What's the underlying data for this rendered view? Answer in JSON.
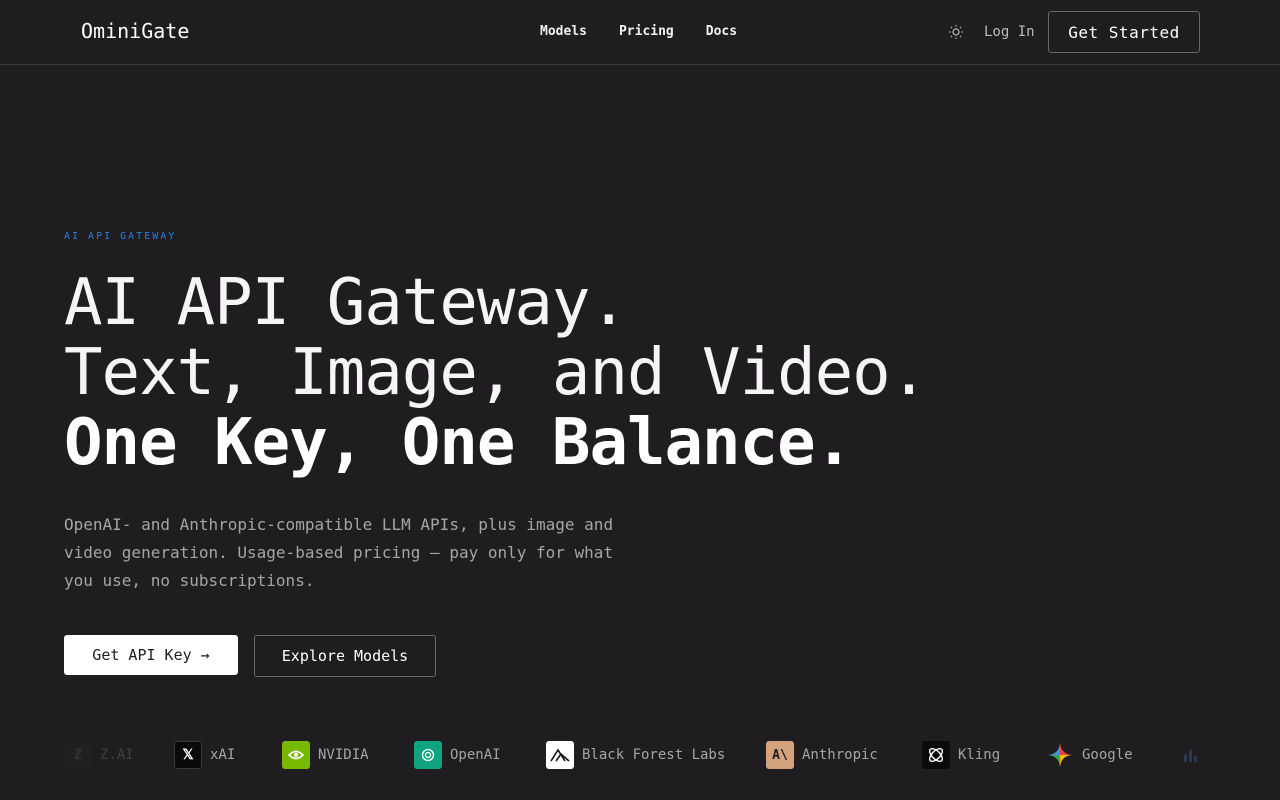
{
  "nav": {
    "brand": "OminiGate",
    "links": [
      "Models",
      "Pricing",
      "Docs"
    ],
    "theme_icon": "sun-icon",
    "login": "Log In",
    "cta": "Get Started"
  },
  "hero": {
    "eyebrow": "AI API GATEWAY",
    "line1": "AI API Gateway.",
    "line2": "Text, Image, and Video.",
    "line3": "One Key, One Balance.",
    "subtext": "OpenAI- and Anthropic-compatible LLM APIs, plus image and video generation. Usage-based pricing — pay only for what you use, no subscriptions.",
    "primary_button": "Get API Key →",
    "secondary_button": "Explore Models",
    "accent_color": "#2a7de1"
  },
  "providers": [
    {
      "name": "Z.AI",
      "icon": "zai-logo-icon"
    },
    {
      "name": "xAI",
      "icon": "xai-logo-icon"
    },
    {
      "name": "NVIDIA",
      "icon": "nvidia-logo-icon"
    },
    {
      "name": "OpenAI",
      "icon": "openai-logo-icon"
    },
    {
      "name": "Black Forest Labs",
      "icon": "black-forest-labs-logo-icon"
    },
    {
      "name": "Anthropic",
      "icon": "anthropic-logo-icon"
    },
    {
      "name": "Kling",
      "icon": "kling-logo-icon"
    },
    {
      "name": "Google",
      "icon": "google-logo-icon"
    }
  ]
}
